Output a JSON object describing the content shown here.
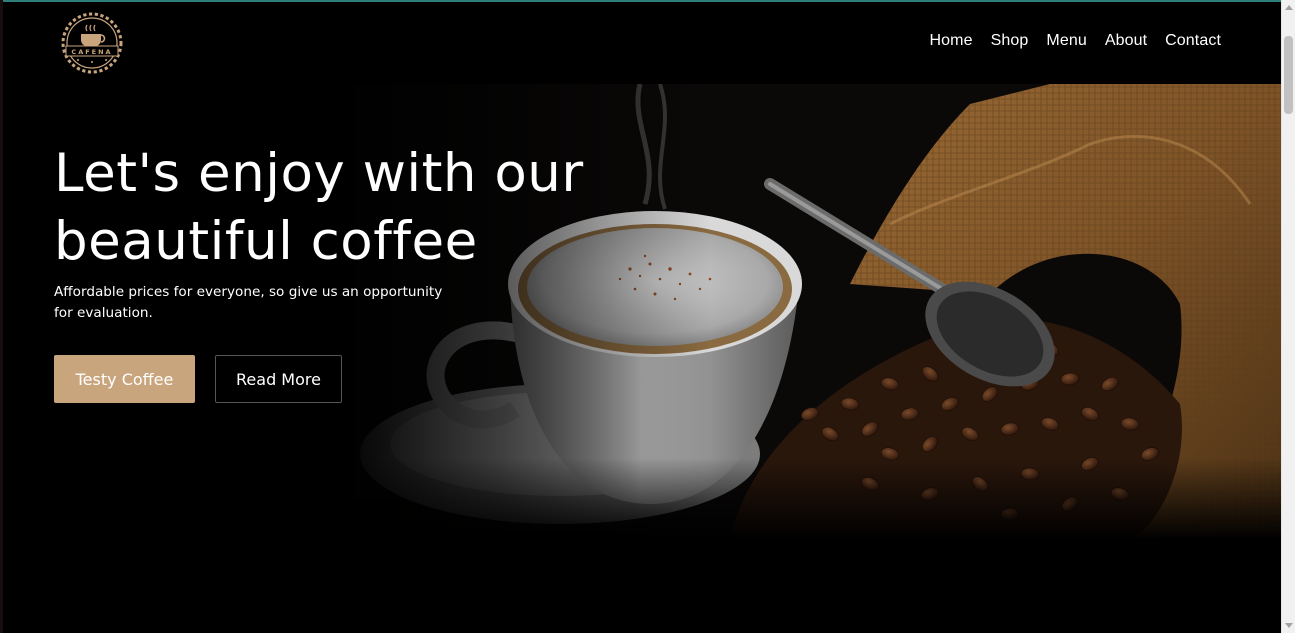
{
  "brand": {
    "logo_text": "CAFENA",
    "logo_icon": "coffee-cup-gear-badge",
    "accent_color": "#c9a57d"
  },
  "nav": {
    "items": [
      "Home",
      "Shop",
      "Menu",
      "About",
      "Contact"
    ]
  },
  "hero": {
    "title_line1": "Let's enjoy with our",
    "title_line2": "beautiful coffee",
    "subtitle_line1": "Affordable prices for everyone, so give us an opportunity",
    "subtitle_line2": "for evaluation.",
    "primary_button": "Testy Coffee",
    "secondary_button": "Read More",
    "image": "coffee-cup-with-beans-and-burlap-sack"
  },
  "colors": {
    "background": "#000000",
    "top_accent": "#2e7f7a",
    "button_primary": "#c9a57d"
  }
}
